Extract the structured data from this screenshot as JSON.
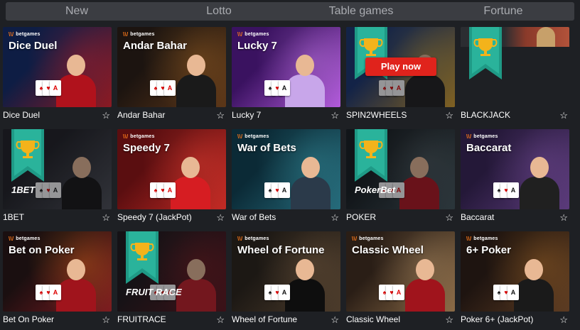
{
  "tabs": [
    {
      "label": "New"
    },
    {
      "label": "Lotto"
    },
    {
      "label": "Table games"
    },
    {
      "label": "Fortune"
    }
  ],
  "brand_text": "betgames",
  "brand_mark": "\\\\/",
  "play_now_label": "Play now",
  "games": [
    {
      "label": "Dice Duel",
      "thumb_title": "Dice Duel",
      "branded": true,
      "bg1": "#0e1d44",
      "bg2": "#8a1a22",
      "accent": "#c81f2a",
      "hair": "#b98a4e",
      "outfit": "#b0121c",
      "suit": "red"
    },
    {
      "label": "Andar Bahar",
      "thumb_title": "Andar Bahar",
      "branded": true,
      "bg1": "#1c1410",
      "bg2": "#5a3518",
      "accent": "#c27a2a",
      "hair": "#2a1a12",
      "outfit": "#1a1a1a",
      "suit": "red"
    },
    {
      "label": "Lucky 7",
      "thumb_title": "Lucky 7",
      "branded": true,
      "bg1": "#3a1260",
      "bg2": "#b25adb",
      "accent": "#d48cf5",
      "hair": "#3b2414",
      "outfit": "#c8a6ea",
      "suit": "black"
    },
    {
      "label": "SPIN2WHEELS",
      "thumb_title": "",
      "branded": false,
      "bg1": "#13306e",
      "bg2": "#d9a02a",
      "accent": "#ffcc33",
      "hair": "#2a1a12",
      "outfit": "#1a1a1a",
      "suit": "red",
      "ribbon": true,
      "play": true
    },
    {
      "label": "BLACKJACK",
      "thumb_title": "",
      "branded": false,
      "bg1": "#2b2d31",
      "bg2": "#2b2d31",
      "accent": "#9a3a2a",
      "hair": "#c7a06a",
      "outfit": "#ffffff",
      "suit": "black",
      "ribbon": true,
      "partial": true
    },
    {
      "label": "1BET",
      "thumb_title": "",
      "branded": false,
      "bg1": "#1a1b20",
      "bg2": "#4a4d55",
      "accent": "#888",
      "hair": "#c9a574",
      "outfit": "#121212",
      "suit": "black",
      "ribbon": true,
      "logo": "1BET"
    },
    {
      "label": "Speedy 7 (JackPot)",
      "thumb_title": "Speedy 7",
      "branded": true,
      "bg1": "#5a0e10",
      "bg2": "#c22a24",
      "accent": "#ff4a3a",
      "hair": "#6a3a1e",
      "outfit": "#d61d22",
      "suit": "red"
    },
    {
      "label": "War of Bets",
      "thumb_title": "War of Bets",
      "branded": true,
      "bg1": "#0b2a36",
      "bg2": "#256a7a",
      "accent": "#3fa3b0",
      "hair": "#b2322a",
      "outfit": "#2b3a4a",
      "suit": "black"
    },
    {
      "label": "POKER",
      "thumb_title": "",
      "branded": false,
      "bg1": "#10171a",
      "bg2": "#3d5157",
      "accent": "#7a8c90",
      "hair": "#2a1a12",
      "outfit": "#b0121c",
      "suit": "red",
      "ribbon": true,
      "logo": "PokerBet"
    },
    {
      "label": "Baccarat",
      "thumb_title": "Baccarat",
      "branded": true,
      "bg1": "#241838",
      "bg2": "#5a3a7a",
      "accent": "#8a5ab0",
      "hair": "#2a1a12",
      "outfit": "#202020",
      "suit": "black"
    },
    {
      "label": "Bet On Poker",
      "thumb_title": "Bet on Poker",
      "branded": true,
      "bg1": "#1a0f10",
      "bg2": "#7a1a20",
      "accent": "#ff7a1a",
      "hair": "#9a6a3e",
      "outfit": "#a0141c",
      "suit": "red"
    },
    {
      "label": "FRUITRACE",
      "thumb_title": "",
      "branded": false,
      "bg1": "#161214",
      "bg2": "#5a1018",
      "accent": "#c21a24",
      "hair": "#2a1a12",
      "outfit": "#c21a24",
      "suit": "red",
      "ribbon": true,
      "logo": "FRUIT RACE"
    },
    {
      "label": "Wheel of Fortune",
      "thumb_title": "Wheel of Fortune",
      "branded": true,
      "bg1": "#1c1814",
      "bg2": "#4a3a2a",
      "accent": "#8a6a4a",
      "hair": "#2a1a12",
      "outfit": "#0e0e0e",
      "suit": "black"
    },
    {
      "label": "Classic Wheel",
      "thumb_title": "Classic Wheel",
      "branded": true,
      "bg1": "#2a1e16",
      "bg2": "#8a6a46",
      "accent": "#c9a474",
      "hair": "#2a1a12",
      "outfit": "#a0141c",
      "suit": "red"
    },
    {
      "label": "Poker 6+ (JackPot)",
      "thumb_title": "6+ Poker",
      "branded": true,
      "bg1": "#1e1410",
      "bg2": "#5a3a22",
      "accent": "#c27a2a",
      "hair": "#3b2414",
      "outfit": "#1a1a1a",
      "suit": "black"
    }
  ]
}
